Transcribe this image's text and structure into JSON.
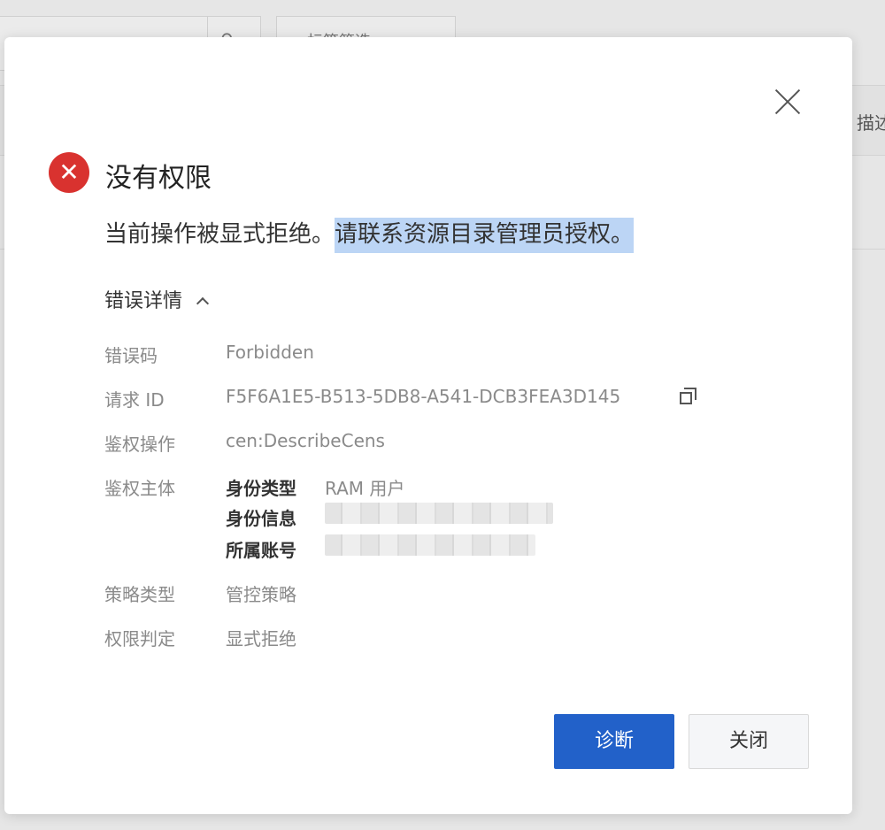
{
  "background": {
    "tag_filter_label": "标签筛选",
    "column_label": "描述"
  },
  "dialog": {
    "title": "没有权限",
    "message_plain": "当前操作被显式拒绝。",
    "message_highlighted": "请联系资源目录管理员授权。",
    "details_toggle_label": "错误详情",
    "details": {
      "error_code_label": "错误码",
      "error_code_value": "Forbidden",
      "request_id_label": "请求 ID",
      "request_id_value": "F5F6A1E5-B513-5DB8-A541-DCB3FEA3D145",
      "auth_action_label": "鉴权操作",
      "auth_action_value": "cen:DescribeCens",
      "principal_label": "鉴权主体",
      "identity_type_key": "身份类型",
      "identity_type_value": "RAM 用户",
      "identity_info_key": "身份信息",
      "account_key": "所属账号",
      "policy_type_label": "策略类型",
      "policy_type_value": "管控策略",
      "decision_label": "权限判定",
      "decision_value": "显式拒绝"
    },
    "buttons": {
      "diagnose": "诊断",
      "close": "关闭"
    },
    "colors": {
      "error": "#d9322f",
      "primary": "#2261c9",
      "highlight": "#bcd5f5"
    }
  }
}
